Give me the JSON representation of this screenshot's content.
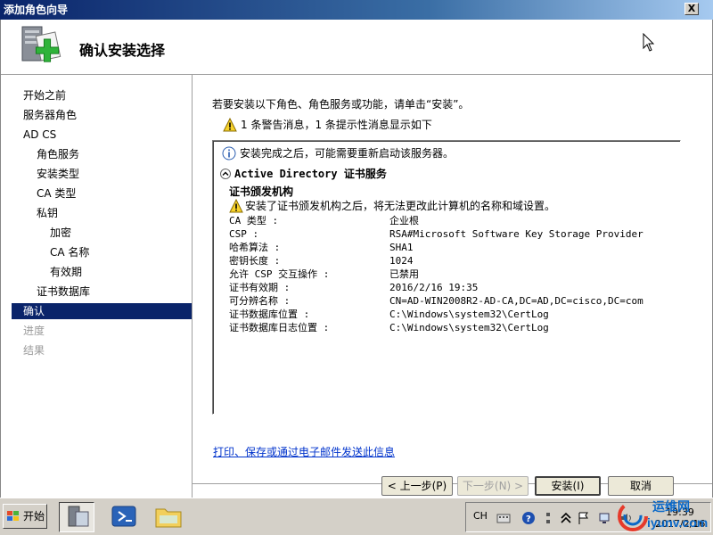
{
  "window": {
    "title": "添加角色向导",
    "close_label": "X"
  },
  "header": {
    "title": "确认安装选择"
  },
  "nav": {
    "items": [
      {
        "label": "开始之前"
      },
      {
        "label": "服务器角色"
      },
      {
        "label": "AD CS"
      },
      {
        "label": "角色服务"
      },
      {
        "label": "安装类型"
      },
      {
        "label": "CA 类型"
      },
      {
        "label": "私钥"
      },
      {
        "label": "加密"
      },
      {
        "label": "CA 名称"
      },
      {
        "label": "有效期"
      },
      {
        "label": "证书数据库"
      },
      {
        "label": "确认"
      },
      {
        "label": "进度"
      },
      {
        "label": "结果"
      }
    ]
  },
  "main": {
    "instruction": "若要安装以下角色、角色服务或功能，请单击“安装”。",
    "summary": "1 条警告消息，1 条提示性消息显示如下",
    "info_message": "安装完成之后，可能需要重新启动该服务器。",
    "section_title_prefix": "Active Directory",
    "section_title_suffix": "证书服务",
    "role_name": "证书颁发机构",
    "role_warning": "安装了证书颁发机构之后，将无法更改此计算机的名称和域设置。",
    "properties": [
      {
        "key": "CA 类型 :",
        "value": "企业根"
      },
      {
        "key": "CSP :",
        "value": "RSA#Microsoft Software Key Storage Provider"
      },
      {
        "key": "哈希算法 :",
        "value": "SHA1"
      },
      {
        "key": "密钥长度 :",
        "value": "1024"
      },
      {
        "key": "允许 CSP 交互操作 :",
        "value": "已禁用"
      },
      {
        "key": "证书有效期 :",
        "value": "2016/2/16 19:35"
      },
      {
        "key": "可分辨名称 :",
        "value": "CN=AD-WIN2008R2-AD-CA,DC=AD,DC=cisco,DC=com"
      },
      {
        "key": "证书数据库位置 :",
        "value": "C:\\Windows\\system32\\CertLog"
      },
      {
        "key": "证书数据库日志位置 :",
        "value": "C:\\Windows\\system32\\CertLog"
      }
    ],
    "link": "打印、保存或通过电子邮件发送此信息"
  },
  "buttons": {
    "prev": "< 上一步(P)",
    "next": "下一步(N) >",
    "install": "安装(I)",
    "cancel": "取消"
  },
  "taskbar": {
    "start": "开始",
    "lang": "CH",
    "clock_time": "19:39",
    "clock_date": "2017/2/16"
  },
  "watermark": {
    "line1": "运维网",
    "line2": "iyunv.com"
  },
  "colors": {
    "selection": "#0a246a",
    "link": "#0033cc",
    "title_gradient_start": "#0a246a"
  }
}
